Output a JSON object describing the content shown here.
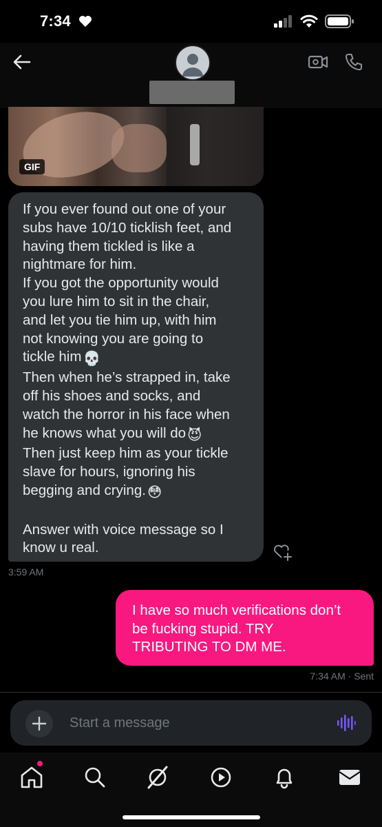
{
  "status_bar": {
    "time": "7:34"
  },
  "conversation": {
    "gif_label": "GIF",
    "incoming_lines": [
      "If you ever found out one of your",
      "subs have 10/10 ticklish feet, and",
      "having them tickled is like a",
      "nightmare for him.",
      "If you got the opportunity would",
      "you lure him to sit in the chair,",
      "and let you tie him up, with him",
      "not knowing you are going to",
      "tickle him",
      "Then when he’s strapped in, take",
      "off his shoes and socks, and",
      "watch the horror in his face when",
      "he knows what you will do",
      "Then just keep him as your tickle",
      "slave for hours, ignoring his",
      "begging and crying.",
      "",
      "Answer with voice message so I",
      "know u real."
    ],
    "incoming_emojis": {
      "skull": "💀",
      "devil": "😈",
      "flushed": "😳"
    },
    "incoming_time": "3:59 AM",
    "outgoing_lines": [
      "I have so much verifications don’t",
      "be fucking stupid. TRY",
      "TRIBUTING TO DM ME."
    ],
    "outgoing_meta": "7:34 AM · Sent"
  },
  "composer": {
    "placeholder": "Start a message"
  },
  "icons": {
    "back": "back-arrow-icon",
    "video": "video-call-icon",
    "phone": "phone-icon",
    "home": "home-icon",
    "search": "search-icon",
    "grok": "grok-icon",
    "video_tab": "video-play-icon",
    "notifications": "bell-icon",
    "messages": "envelope-icon"
  },
  "colors": {
    "accent_pink": "#f91880",
    "voice_purple": "#7856ff",
    "incoming_bubble": "#2f3336"
  }
}
